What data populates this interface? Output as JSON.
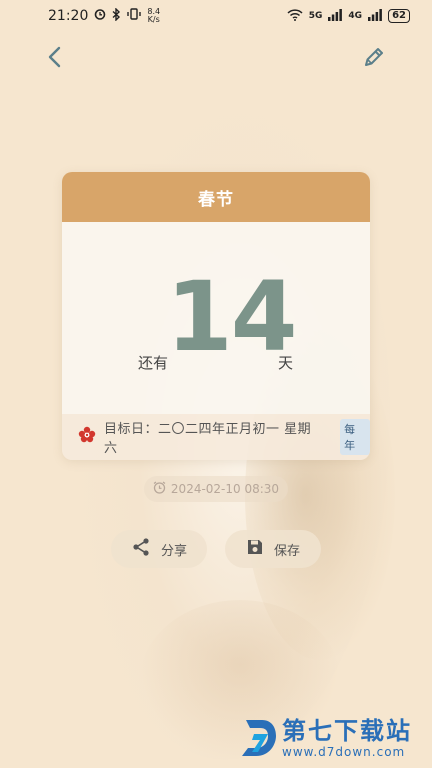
{
  "status_bar": {
    "time": "21:20",
    "speed_value": "8.4",
    "speed_unit": "K/s",
    "signal_1": "5G",
    "signal_2": "4G",
    "battery": "62"
  },
  "header": {
    "back_icon": "chevron-left-icon",
    "edit_icon": "pencil-icon"
  },
  "event": {
    "title": "春节",
    "prefix": "还有",
    "days": "14",
    "suffix": "天",
    "target_label": "目标日：二〇二四年正月初一 星期六",
    "repeat_badge": "每年",
    "timestamp": "2024-02-10 08:30"
  },
  "actions": {
    "share_label": "分享",
    "save_label": "保存"
  },
  "watermark": {
    "title": "第七下载站",
    "url": "www.d7down.com"
  },
  "colors": {
    "background": "#f6e6cf",
    "header_accent": "#d8a569",
    "number_color": "#7c948a",
    "badge_bg": "#d8e4ee",
    "watermark_blue": "#2a6fb8"
  }
}
